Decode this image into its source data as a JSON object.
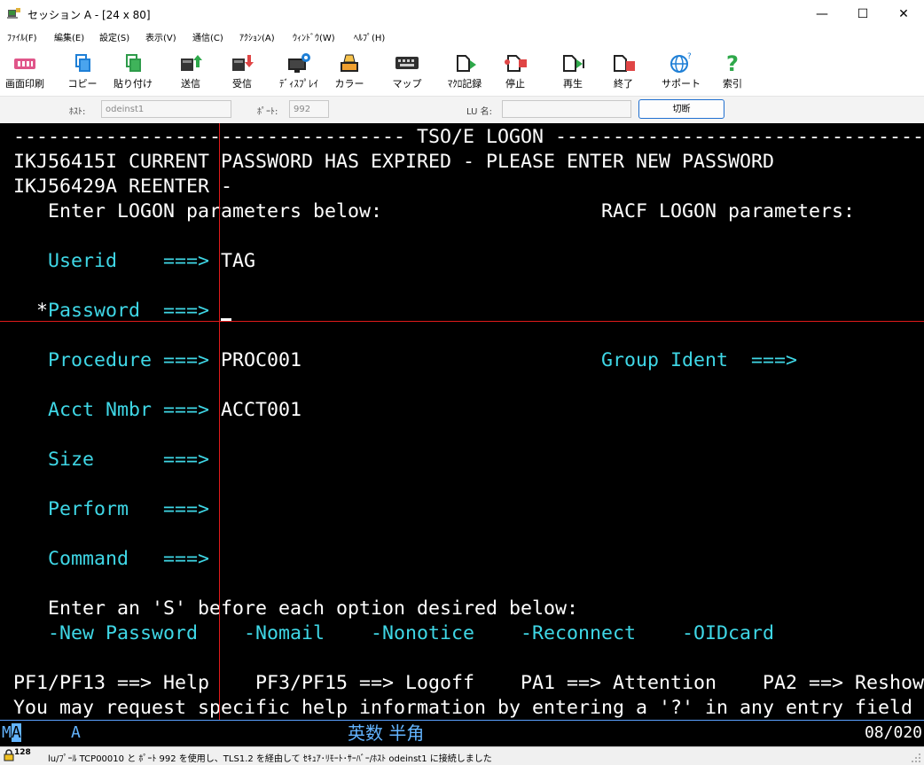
{
  "window": {
    "title": "セッション A - [24 x 80]",
    "controls": {
      "minimize": "—",
      "maximize": "☐",
      "close": "✕"
    }
  },
  "menu": [
    "ﾌｧｲﾙ(F)",
    "編集(E)",
    "設定(S)",
    "表示(V)",
    "通信(C)",
    "ｱｸｼｮﾝ(A)",
    "ｳｨﾝﾄﾞｳ(W)",
    "ﾍﾙﾌﾟ(H)"
  ],
  "toolbar": [
    {
      "label": "画面印刷",
      "icon": "print-screen-icon"
    },
    {
      "label": "コピー",
      "icon": "copy-icon"
    },
    {
      "label": "貼り付け",
      "icon": "paste-icon"
    },
    {
      "label": "送信",
      "icon": "send-icon"
    },
    {
      "label": "受信",
      "icon": "receive-icon"
    },
    {
      "label": "ﾃﾞｨｽﾌﾟﾚｲ",
      "icon": "display-icon"
    },
    {
      "label": "カラー",
      "icon": "color-icon"
    },
    {
      "label": "マップ",
      "icon": "keyboard-map-icon"
    },
    {
      "label": "ﾏｸﾛ記録",
      "icon": "macro-record-icon"
    },
    {
      "label": "停止",
      "icon": "stop-icon"
    },
    {
      "label": "再生",
      "icon": "play-icon"
    },
    {
      "label": "終了",
      "icon": "exit-icon"
    },
    {
      "label": "サポート",
      "icon": "support-icon"
    },
    {
      "label": "索引",
      "icon": "help-index-icon"
    }
  ],
  "connection": {
    "host_label": "ﾎｽﾄ:",
    "host_value": "odeinst1",
    "port_label": "ﾎﾟｰﾄ:",
    "port_value": "992",
    "lu_label": "LU 名:",
    "lu_value": "",
    "disconnect_label": "切断"
  },
  "terminal": {
    "lines": [
      [
        {
          "t": "---------------------------------- TSO/E LOGON -----------------------------------",
          "c": "w"
        }
      ],
      [
        {
          "t": "IKJ56415I CURRENT PASSWORD HAS EXPIRED - PLEASE ENTER NEW PASSWORD",
          "c": "w"
        }
      ],
      [
        {
          "t": "IKJ56429A REENTER -",
          "c": "w"
        }
      ],
      [
        {
          "t": "   Enter LOGON parameters below:                   RACF LOGON parameters:",
          "c": "w"
        }
      ],
      [],
      [
        {
          "t": "   Userid    ===> ",
          "c": "c"
        },
        {
          "t": "TAG",
          "c": "w"
        }
      ],
      [],
      [
        {
          "t": "  *",
          "c": "w"
        },
        {
          "t": "Password  ===> ",
          "c": "c"
        }
      ],
      [],
      [
        {
          "t": "   Procedure ===> ",
          "c": "c"
        },
        {
          "t": "PROC001",
          "c": "w"
        },
        {
          "t": "                          Group Ident  ===>",
          "c": "c"
        }
      ],
      [],
      [
        {
          "t": "   Acct Nmbr ===> ",
          "c": "c"
        },
        {
          "t": "ACCT001",
          "c": "w"
        }
      ],
      [],
      [
        {
          "t": "   Size      ===>",
          "c": "c"
        }
      ],
      [],
      [
        {
          "t": "   Perform   ===>",
          "c": "c"
        }
      ],
      [],
      [
        {
          "t": "   Command   ===>",
          "c": "c"
        }
      ],
      [],
      [
        {
          "t": "   Enter an 'S' before each option desired below:",
          "c": "w"
        }
      ],
      [
        {
          "t": "   -New Password    -Nomail    -Nonotice    -Reconnect    -OIDcard",
          "c": "c"
        }
      ],
      [],
      [
        {
          "t": "PF1/PF13 ==> Help    PF3/PF15 ==> Logoff    PA1 ==> Attention    PA2 ==> Reshow",
          "c": "w"
        }
      ],
      [
        {
          "t": "You may request specific help information by entering a '?' in any entry field",
          "c": "w"
        }
      ]
    ]
  },
  "oia": {
    "ma_first": "M",
    "ma_second": "A",
    "mode": "A",
    "ime": "英数 半角",
    "cursor_position": "08/020"
  },
  "statusbar": {
    "encryption_bits": "128",
    "message": "lu/ﾌﾟｰﾙ TCP00010 と ﾎﾟｰﾄ 992 を使用し、TLS1.2 を経由して ｾｷｭｱ･ﾘﾓｰﾄ･ｻｰﾊﾞｰ/ﾎｽﾄ odeinst1 に接続しました"
  }
}
